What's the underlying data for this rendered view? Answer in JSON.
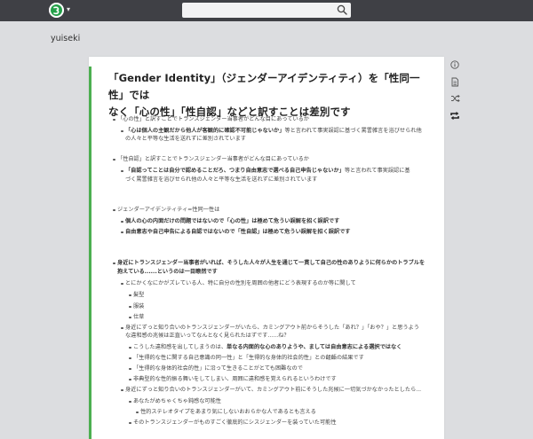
{
  "header": {
    "search_placeholder": ""
  },
  "project": {
    "name": "yuiseki"
  },
  "page": {
    "title_line1": "「Gender Identity」（ジェンダーアイデンティティ）を「性同一性」では",
    "title_line2": "なく「心の性」「性自認」などと訳すことは差別です"
  },
  "blocks": [
    {
      "indent": 1,
      "parts": [
        {
          "t": "「心の性」と訳すことでトランスジェンダー当事者がどんな目にあっているか"
        }
      ]
    },
    {
      "indent": 2,
      "parts": [
        {
          "t": "「心は個人の主観だから他人が客観的に確認不可能じゃないか」",
          "b": true
        },
        {
          "t": "等と言われて事実誤認に基づく罵詈雑言を浴びせられ他"
        }
      ]
    },
    {
      "indent": 2,
      "cont": true,
      "parts": [
        {
          "t": "の人々と平等な生活を送れずに差別されています"
        }
      ]
    },
    {
      "indent": 1,
      "parts": [
        {
          "t": "「性自認」と訳すことでトランスジェンダー当事者がどんな目にあっているか"
        }
      ]
    },
    {
      "indent": 2,
      "parts": [
        {
          "t": "「自認ってことは自分で認めることだろ、つまり自由意志で選べる自己申告じゃないか」",
          "b": true
        },
        {
          "t": "等と言われて事実誤認に基"
        }
      ]
    },
    {
      "indent": 2,
      "cont": true,
      "parts": [
        {
          "t": "づく罵詈雑言を浴びせられ他の人々と平等な生活を送れずに差別されています"
        }
      ]
    },
    {
      "indent": 1,
      "parts": [
        {
          "t": "ジェンダーアイデンティティ=性同一性は"
        }
      ]
    },
    {
      "indent": 2,
      "parts": [
        {
          "t": "個人の心の内面だけの問題ではないので「心の性」は極めて危うい誤解を招く誤訳です",
          "b": true
        }
      ]
    },
    {
      "indent": 2,
      "parts": [
        {
          "t": "自由意志や自己申告による自認ではないので「性自認」は極めて危うい誤解を招く誤訳です",
          "b": true
        }
      ]
    },
    {
      "indent": 1,
      "parts": [
        {
          "t": "身近にトランスジェンダー当事者がいれば、そうした人々が人生を通じて一貫して自己の性のありように何らかのトラブルを",
          "b": true
        }
      ]
    },
    {
      "indent": 1,
      "cont": true,
      "parts": [
        {
          "t": "抱えている......というのは一目瞭然です",
          "b": true
        }
      ]
    },
    {
      "indent": 2,
      "parts": [
        {
          "t": "とにかくなにかがズレている人、特に自分の性別を周囲の他者にどう表現するのか等に関して"
        }
      ]
    },
    {
      "indent": 3,
      "parts": [
        {
          "t": "髪型"
        }
      ]
    },
    {
      "indent": 3,
      "parts": [
        {
          "t": "服装"
        }
      ]
    },
    {
      "indent": 3,
      "parts": [
        {
          "t": "仕草"
        }
      ]
    },
    {
      "indent": 2,
      "parts": [
        {
          "t": "身近にずっと知り合いのトランスジェンダーがいたら、カミングアウト前からそうした「あれ？」「おや？」と思うよう"
        }
      ]
    },
    {
      "indent": 2,
      "cont": true,
      "parts": [
        {
          "t": "な違和感の兆候は正直いってなんとなく見られたはずです......ね？"
        }
      ]
    },
    {
      "indent": 3,
      "parts": [
        {
          "t": "こうした違和感を出してしまうのは、"
        },
        {
          "t": "単なる内面的な心のありようや、ましては自由意志による選択ではなく",
          "b": true
        }
      ]
    },
    {
      "indent": 3,
      "parts": [
        {
          "t": "「生得的な性に関する自己意識の同一性」と「生得的な身体的社会的性」との齟齬の結果です"
        }
      ]
    },
    {
      "indent": 3,
      "parts": [
        {
          "t": "「生得的な身体的社会的性」に沿って生きることがとても困難なので"
        }
      ]
    },
    {
      "indent": 3,
      "parts": [
        {
          "t": "非典型的な性的振る舞いをしてしまい、周囲に違和感を覚えられるというわけです"
        }
      ]
    },
    {
      "indent": 2,
      "parts": [
        {
          "t": "身近にずっと知り合いのトランスジェンダーがいて、カミングアウト前にそうした兆候に一切気づかなかったとしたら..."
        }
      ]
    },
    {
      "indent": 3,
      "parts": [
        {
          "t": "あなたがめちゃくちゃ鈍感な可能性"
        }
      ]
    },
    {
      "indent": 4,
      "parts": [
        {
          "t": "性的ステレオタイプをあまり気にしないおおらかな人であるとも言える"
        }
      ]
    },
    {
      "indent": 3,
      "parts": [
        {
          "t": "そのトランスジェンダーがものすごく徹底的にシスジェンダーを装っていた可能性"
        }
      ]
    }
  ]
}
